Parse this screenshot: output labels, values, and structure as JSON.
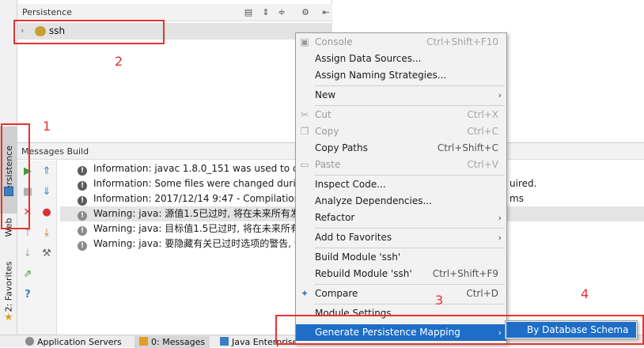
{
  "left_strip": {
    "tabs": [
      "Persistence",
      "Web",
      "2: Favorites"
    ]
  },
  "persistence": {
    "title": "Persistence",
    "tree_item": "ssh",
    "toolbar_icons": [
      "er-diagram-icon",
      "expand-all-icon",
      "collapse-all-icon",
      "gear-icon",
      "hide-icon"
    ]
  },
  "messages": {
    "title": "Messages Build",
    "lines": [
      {
        "type": "info",
        "text": "Information: javac 1.8.0_151 was used to co"
      },
      {
        "type": "info",
        "text": "Information: Some files were changed durin"
      },
      {
        "type": "info",
        "text": "Information: 2017/12/14 9:47 - Compilation"
      },
      {
        "type": "warning",
        "text": "Warning: java: 源值1.5已过时, 将在未来所有发"
      },
      {
        "type": "warning",
        "text": "Warning: java: 目标值1.5已过时, 将在未来所有"
      },
      {
        "type": "warning",
        "text": "Warning: java: 要隐藏有关已过时选项的警告, 请"
      }
    ],
    "line_suffixes": [
      "",
      "uired.",
      "ms",
      "",
      "",
      ""
    ]
  },
  "bottom_bar": {
    "tabs": [
      "Application Servers",
      "0: Messages",
      "Java Enterprise"
    ]
  },
  "context_menu": {
    "items": [
      {
        "label": "Console",
        "shortcut": "Ctrl+Shift+F10",
        "disabled": true,
        "icon": "console-icon"
      },
      {
        "label": "Assign Data Sources...",
        "shortcut": ""
      },
      {
        "label": "Assign Naming Strategies...",
        "shortcut": ""
      },
      {
        "label": "New",
        "submenu": true
      },
      {
        "label": "Cut",
        "shortcut": "Ctrl+X",
        "disabled": true,
        "icon": "cut-icon"
      },
      {
        "label": "Copy",
        "shortcut": "Ctrl+C",
        "disabled": true,
        "icon": "copy-icon"
      },
      {
        "label": "Copy Paths",
        "shortcut": "Ctrl+Shift+C"
      },
      {
        "label": "Paste",
        "shortcut": "Ctrl+V",
        "disabled": true,
        "icon": "paste-icon"
      },
      {
        "label": "Inspect Code...",
        "shortcut": ""
      },
      {
        "label": "Analyze Dependencies...",
        "shortcut": ""
      },
      {
        "label": "Refactor",
        "submenu": true
      },
      {
        "label": "Add to Favorites",
        "submenu": true
      },
      {
        "label": "Build Module 'ssh'",
        "shortcut": ""
      },
      {
        "label": "Rebuild Module 'ssh'",
        "shortcut": "Ctrl+Shift+F9"
      },
      {
        "label": "Compare",
        "shortcut": "Ctrl+D",
        "icon": "compare-icon"
      },
      {
        "label": "Module Settings",
        "shortcut": ""
      },
      {
        "label": "Generate Persistence Mapping",
        "submenu": true,
        "highlighted": true
      }
    ]
  },
  "submenu": {
    "item": "By Database Schema"
  },
  "annotations": [
    "1",
    "2",
    "3",
    "4"
  ],
  "colors": {
    "highlight": "#1e6ec8",
    "annotation": "#e8322f"
  }
}
